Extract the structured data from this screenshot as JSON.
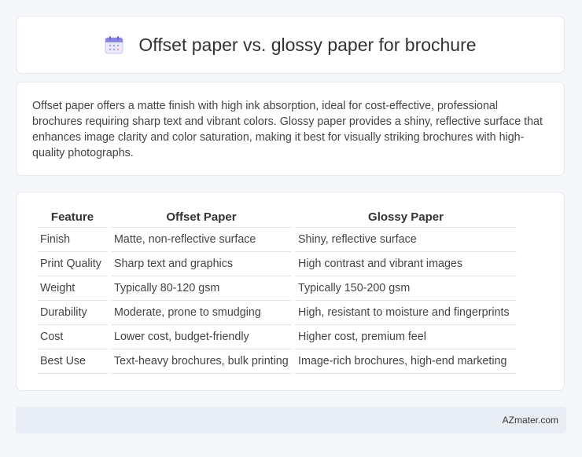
{
  "header": {
    "title": "Offset paper vs. glossy paper for brochure",
    "icon": "calendar-icon"
  },
  "description": "Offset paper offers a matte finish with high ink absorption, ideal for cost-effective, professional brochures requiring sharp text and vibrant colors. Glossy paper provides a shiny, reflective surface that enhances image clarity and color saturation, making it best for visually striking brochures with high-quality photographs.",
  "table": {
    "headers": [
      "Feature",
      "Offset Paper",
      "Glossy Paper"
    ],
    "rows": [
      [
        "Finish",
        "Matte, non-reflective surface",
        "Shiny, reflective surface"
      ],
      [
        "Print Quality",
        "Sharp text and graphics",
        "High contrast and vibrant images"
      ],
      [
        "Weight",
        "Typically 80-120 gsm",
        "Typically 150-200 gsm"
      ],
      [
        "Durability",
        "Moderate, prone to smudging",
        "High, resistant to moisture and fingerprints"
      ],
      [
        "Cost",
        "Lower cost, budget-friendly",
        "Higher cost, premium feel"
      ],
      [
        "Best Use",
        "Text-heavy brochures, bulk printing",
        "Image-rich brochures, high-end marketing"
      ]
    ]
  },
  "footer": {
    "site": "AZmater.com"
  },
  "colors": {
    "background": "#f5f7fa",
    "card": "#ffffff",
    "footer": "#e9eef6",
    "icon_accent": "#8a86e0"
  }
}
